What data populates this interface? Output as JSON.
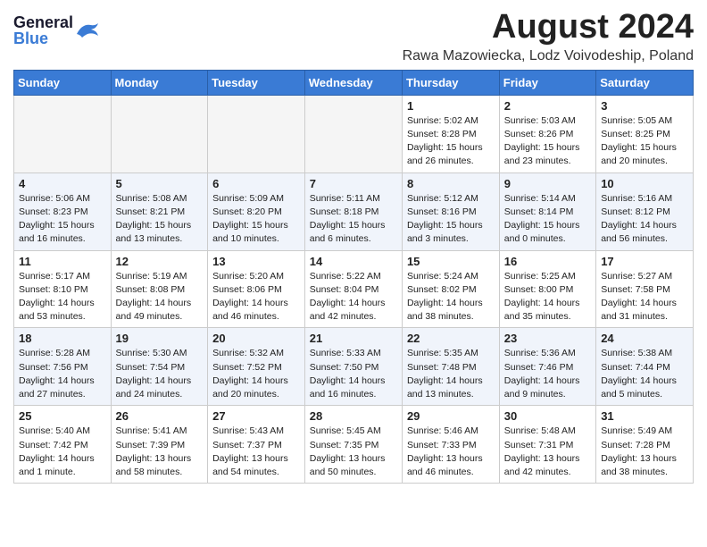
{
  "header": {
    "logo_general": "General",
    "logo_blue": "Blue",
    "title": "August 2024",
    "subtitle": "Rawa Mazowiecka, Lodz Voivodeship, Poland"
  },
  "weekdays": [
    "Sunday",
    "Monday",
    "Tuesday",
    "Wednesday",
    "Thursday",
    "Friday",
    "Saturday"
  ],
  "weeks": [
    [
      {
        "day": "",
        "info": ""
      },
      {
        "day": "",
        "info": ""
      },
      {
        "day": "",
        "info": ""
      },
      {
        "day": "",
        "info": ""
      },
      {
        "day": "1",
        "info": "Sunrise: 5:02 AM\nSunset: 8:28 PM\nDaylight: 15 hours\nand 26 minutes."
      },
      {
        "day": "2",
        "info": "Sunrise: 5:03 AM\nSunset: 8:26 PM\nDaylight: 15 hours\nand 23 minutes."
      },
      {
        "day": "3",
        "info": "Sunrise: 5:05 AM\nSunset: 8:25 PM\nDaylight: 15 hours\nand 20 minutes."
      }
    ],
    [
      {
        "day": "4",
        "info": "Sunrise: 5:06 AM\nSunset: 8:23 PM\nDaylight: 15 hours\nand 16 minutes."
      },
      {
        "day": "5",
        "info": "Sunrise: 5:08 AM\nSunset: 8:21 PM\nDaylight: 15 hours\nand 13 minutes."
      },
      {
        "day": "6",
        "info": "Sunrise: 5:09 AM\nSunset: 8:20 PM\nDaylight: 15 hours\nand 10 minutes."
      },
      {
        "day": "7",
        "info": "Sunrise: 5:11 AM\nSunset: 8:18 PM\nDaylight: 15 hours\nand 6 minutes."
      },
      {
        "day": "8",
        "info": "Sunrise: 5:12 AM\nSunset: 8:16 PM\nDaylight: 15 hours\nand 3 minutes."
      },
      {
        "day": "9",
        "info": "Sunrise: 5:14 AM\nSunset: 8:14 PM\nDaylight: 15 hours\nand 0 minutes."
      },
      {
        "day": "10",
        "info": "Sunrise: 5:16 AM\nSunset: 8:12 PM\nDaylight: 14 hours\nand 56 minutes."
      }
    ],
    [
      {
        "day": "11",
        "info": "Sunrise: 5:17 AM\nSunset: 8:10 PM\nDaylight: 14 hours\nand 53 minutes."
      },
      {
        "day": "12",
        "info": "Sunrise: 5:19 AM\nSunset: 8:08 PM\nDaylight: 14 hours\nand 49 minutes."
      },
      {
        "day": "13",
        "info": "Sunrise: 5:20 AM\nSunset: 8:06 PM\nDaylight: 14 hours\nand 46 minutes."
      },
      {
        "day": "14",
        "info": "Sunrise: 5:22 AM\nSunset: 8:04 PM\nDaylight: 14 hours\nand 42 minutes."
      },
      {
        "day": "15",
        "info": "Sunrise: 5:24 AM\nSunset: 8:02 PM\nDaylight: 14 hours\nand 38 minutes."
      },
      {
        "day": "16",
        "info": "Sunrise: 5:25 AM\nSunset: 8:00 PM\nDaylight: 14 hours\nand 35 minutes."
      },
      {
        "day": "17",
        "info": "Sunrise: 5:27 AM\nSunset: 7:58 PM\nDaylight: 14 hours\nand 31 minutes."
      }
    ],
    [
      {
        "day": "18",
        "info": "Sunrise: 5:28 AM\nSunset: 7:56 PM\nDaylight: 14 hours\nand 27 minutes."
      },
      {
        "day": "19",
        "info": "Sunrise: 5:30 AM\nSunset: 7:54 PM\nDaylight: 14 hours\nand 24 minutes."
      },
      {
        "day": "20",
        "info": "Sunrise: 5:32 AM\nSunset: 7:52 PM\nDaylight: 14 hours\nand 20 minutes."
      },
      {
        "day": "21",
        "info": "Sunrise: 5:33 AM\nSunset: 7:50 PM\nDaylight: 14 hours\nand 16 minutes."
      },
      {
        "day": "22",
        "info": "Sunrise: 5:35 AM\nSunset: 7:48 PM\nDaylight: 14 hours\nand 13 minutes."
      },
      {
        "day": "23",
        "info": "Sunrise: 5:36 AM\nSunset: 7:46 PM\nDaylight: 14 hours\nand 9 minutes."
      },
      {
        "day": "24",
        "info": "Sunrise: 5:38 AM\nSunset: 7:44 PM\nDaylight: 14 hours\nand 5 minutes."
      }
    ],
    [
      {
        "day": "25",
        "info": "Sunrise: 5:40 AM\nSunset: 7:42 PM\nDaylight: 14 hours\nand 1 minute."
      },
      {
        "day": "26",
        "info": "Sunrise: 5:41 AM\nSunset: 7:39 PM\nDaylight: 13 hours\nand 58 minutes."
      },
      {
        "day": "27",
        "info": "Sunrise: 5:43 AM\nSunset: 7:37 PM\nDaylight: 13 hours\nand 54 minutes."
      },
      {
        "day": "28",
        "info": "Sunrise: 5:45 AM\nSunset: 7:35 PM\nDaylight: 13 hours\nand 50 minutes."
      },
      {
        "day": "29",
        "info": "Sunrise: 5:46 AM\nSunset: 7:33 PM\nDaylight: 13 hours\nand 46 minutes."
      },
      {
        "day": "30",
        "info": "Sunrise: 5:48 AM\nSunset: 7:31 PM\nDaylight: 13 hours\nand 42 minutes."
      },
      {
        "day": "31",
        "info": "Sunrise: 5:49 AM\nSunset: 7:28 PM\nDaylight: 13 hours\nand 38 minutes."
      }
    ]
  ]
}
